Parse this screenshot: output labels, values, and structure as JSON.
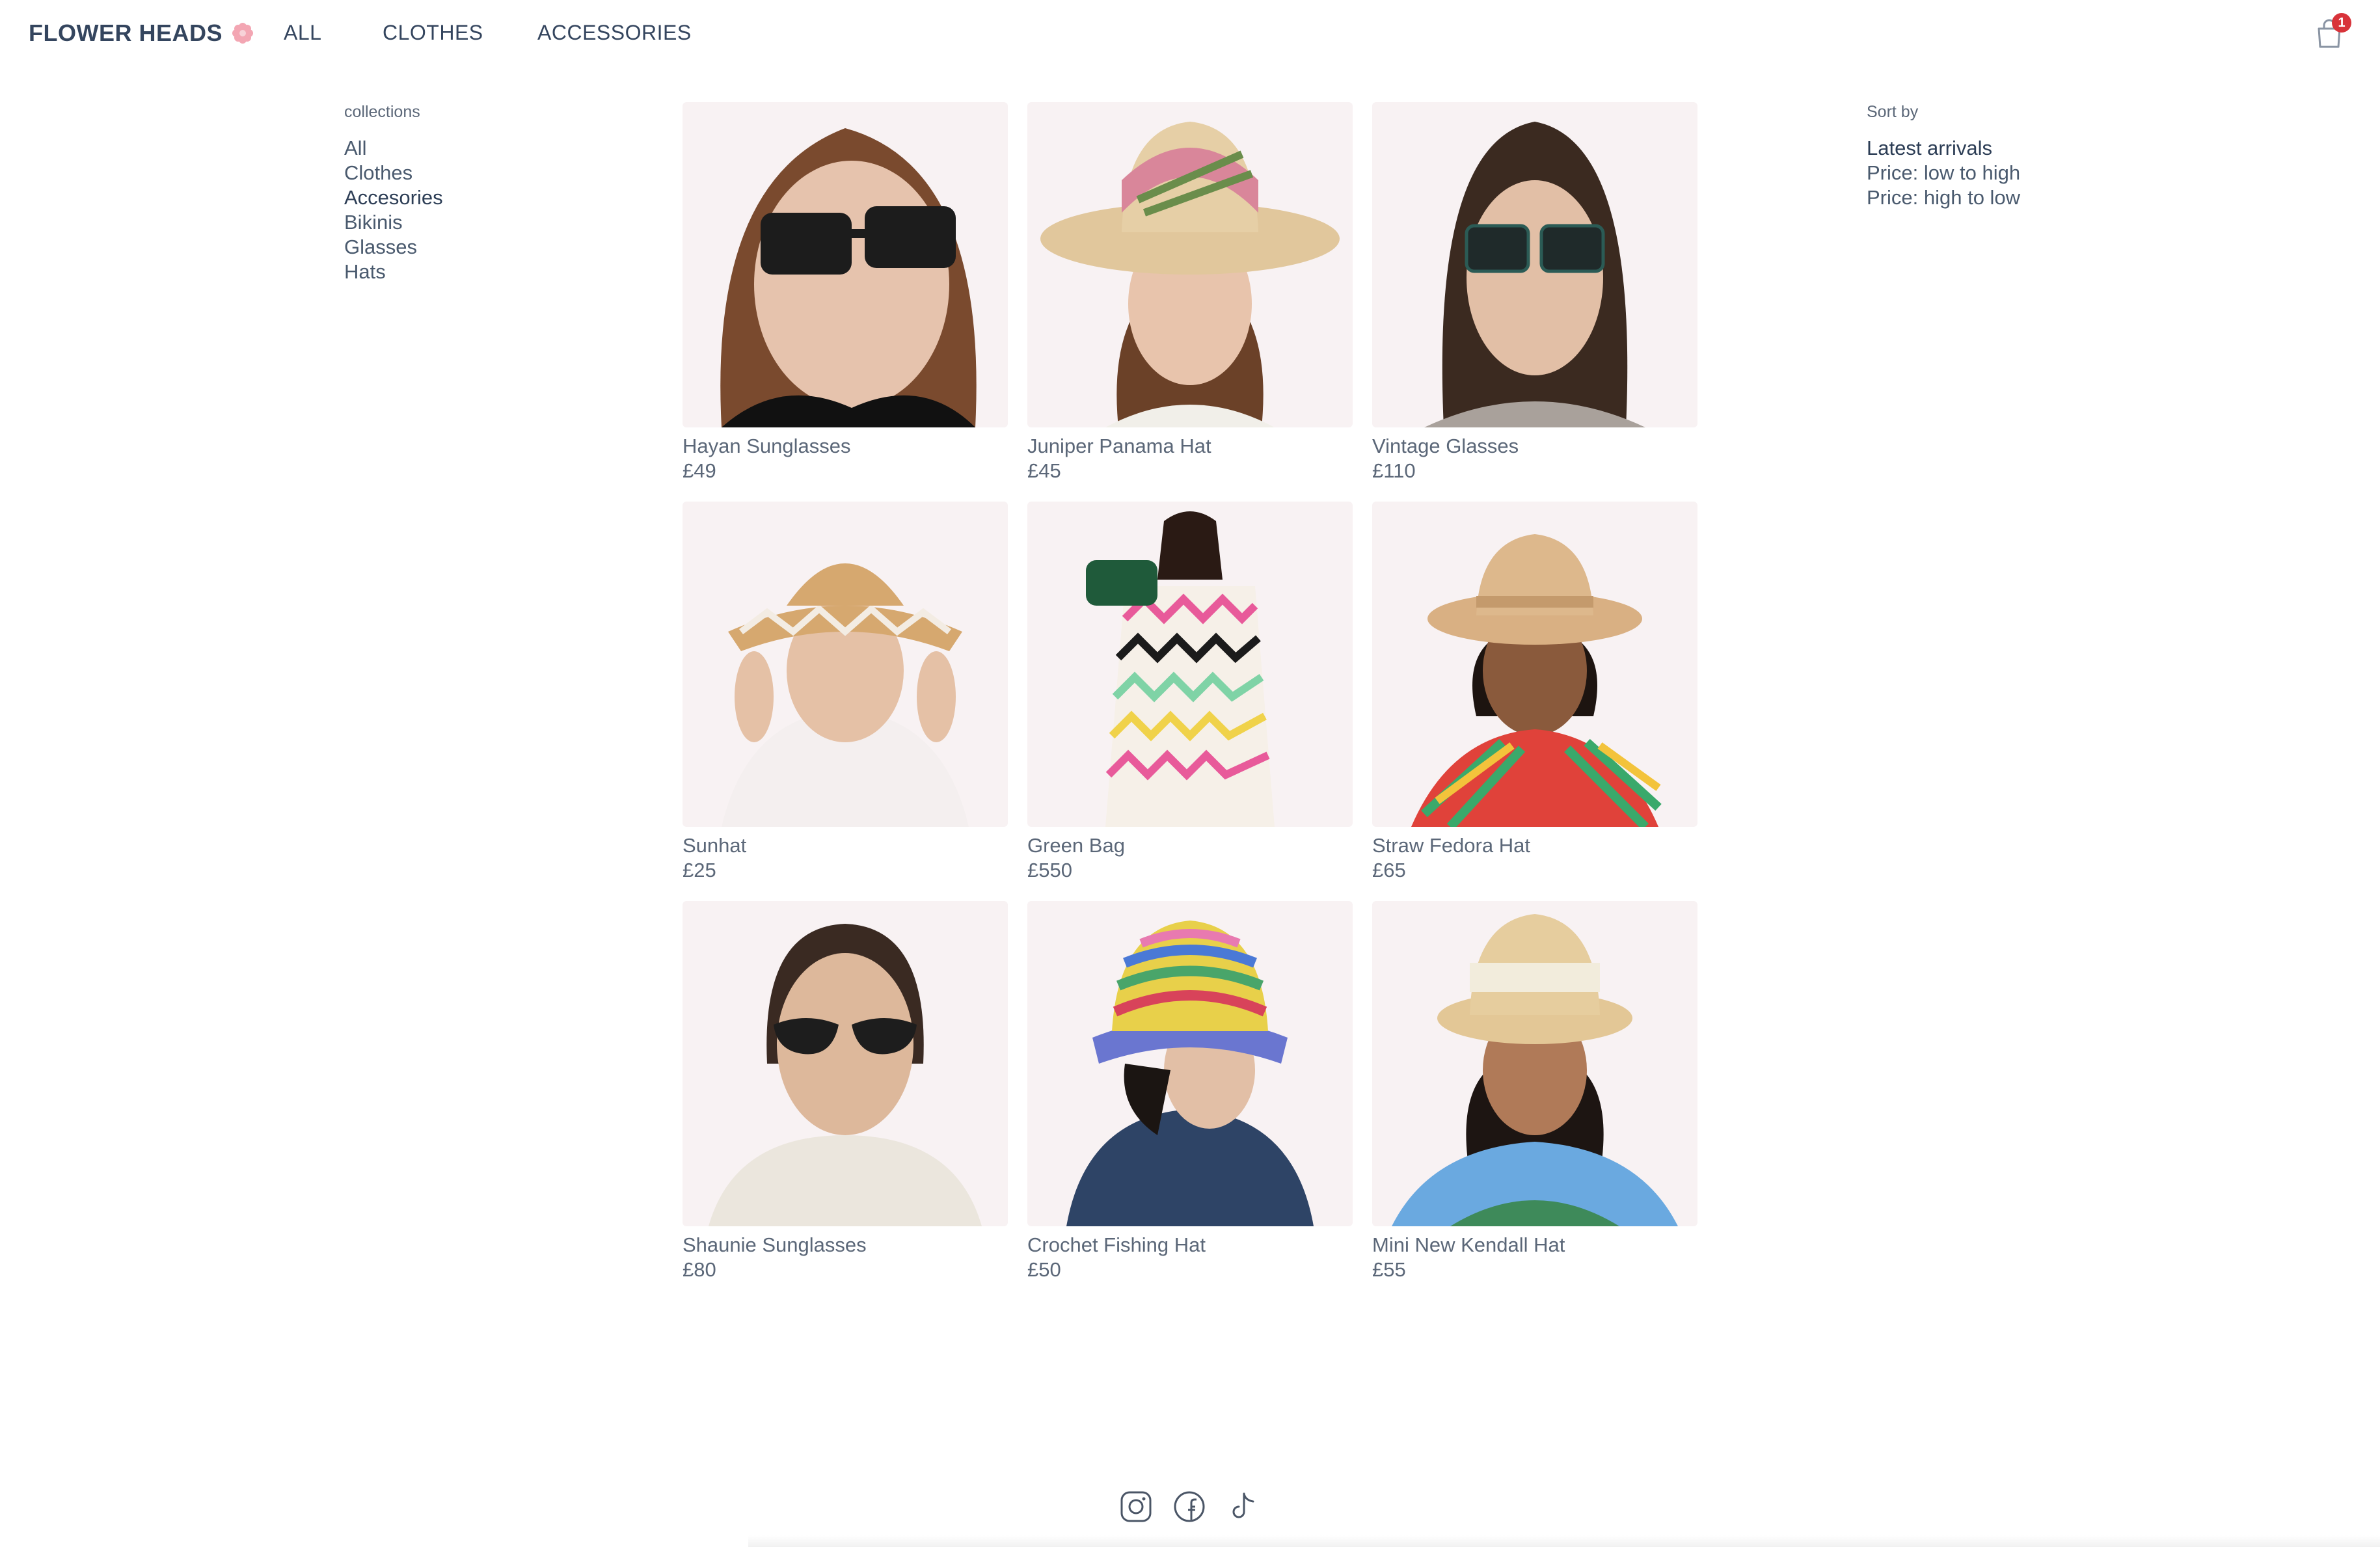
{
  "header": {
    "brand": "FLOWER HEADS",
    "nav": [
      "ALL",
      "CLOTHES",
      "ACCESSORIES"
    ],
    "cart_count": "1"
  },
  "sidebar": {
    "heading": "collections",
    "items": [
      "All",
      "Clothes",
      "Accesories",
      "Bikinis",
      "Glasses",
      "Hats"
    ]
  },
  "sort": {
    "heading": "Sort by",
    "options": [
      "Latest arrivals",
      "Price: low to high",
      "Price: high to low"
    ]
  },
  "products": [
    {
      "name": "Hayan Sunglasses",
      "price": "£49",
      "icon": "sunglasses-icon"
    },
    {
      "name": "Juniper Panama Hat",
      "price": "£45",
      "icon": "hat-icon"
    },
    {
      "name": "Vintage Glasses",
      "price": "£110",
      "icon": "sunglasses-icon"
    },
    {
      "name": "Sunhat",
      "price": "£25",
      "icon": "hat-icon"
    },
    {
      "name": "Green Bag",
      "price": "£550",
      "icon": "bag-icon"
    },
    {
      "name": "Straw Fedora Hat",
      "price": "£65",
      "icon": "hat-icon"
    },
    {
      "name": "Shaunie Sunglasses",
      "price": "£80",
      "icon": "sunglasses-icon"
    },
    {
      "name": "Crochet Fishing Hat",
      "price": "£50",
      "icon": "hat-icon"
    },
    {
      "name": "Mini New Kendall Hat",
      "price": "£55",
      "icon": "hat-icon"
    }
  ],
  "footer": {
    "socials": [
      "instagram-icon",
      "facebook-icon",
      "tiktok-icon"
    ]
  },
  "colors": {
    "text": "#34455e",
    "card_bg": "#f8f2f3",
    "badge": "#d8333a",
    "flower": "#f3a6b3"
  }
}
